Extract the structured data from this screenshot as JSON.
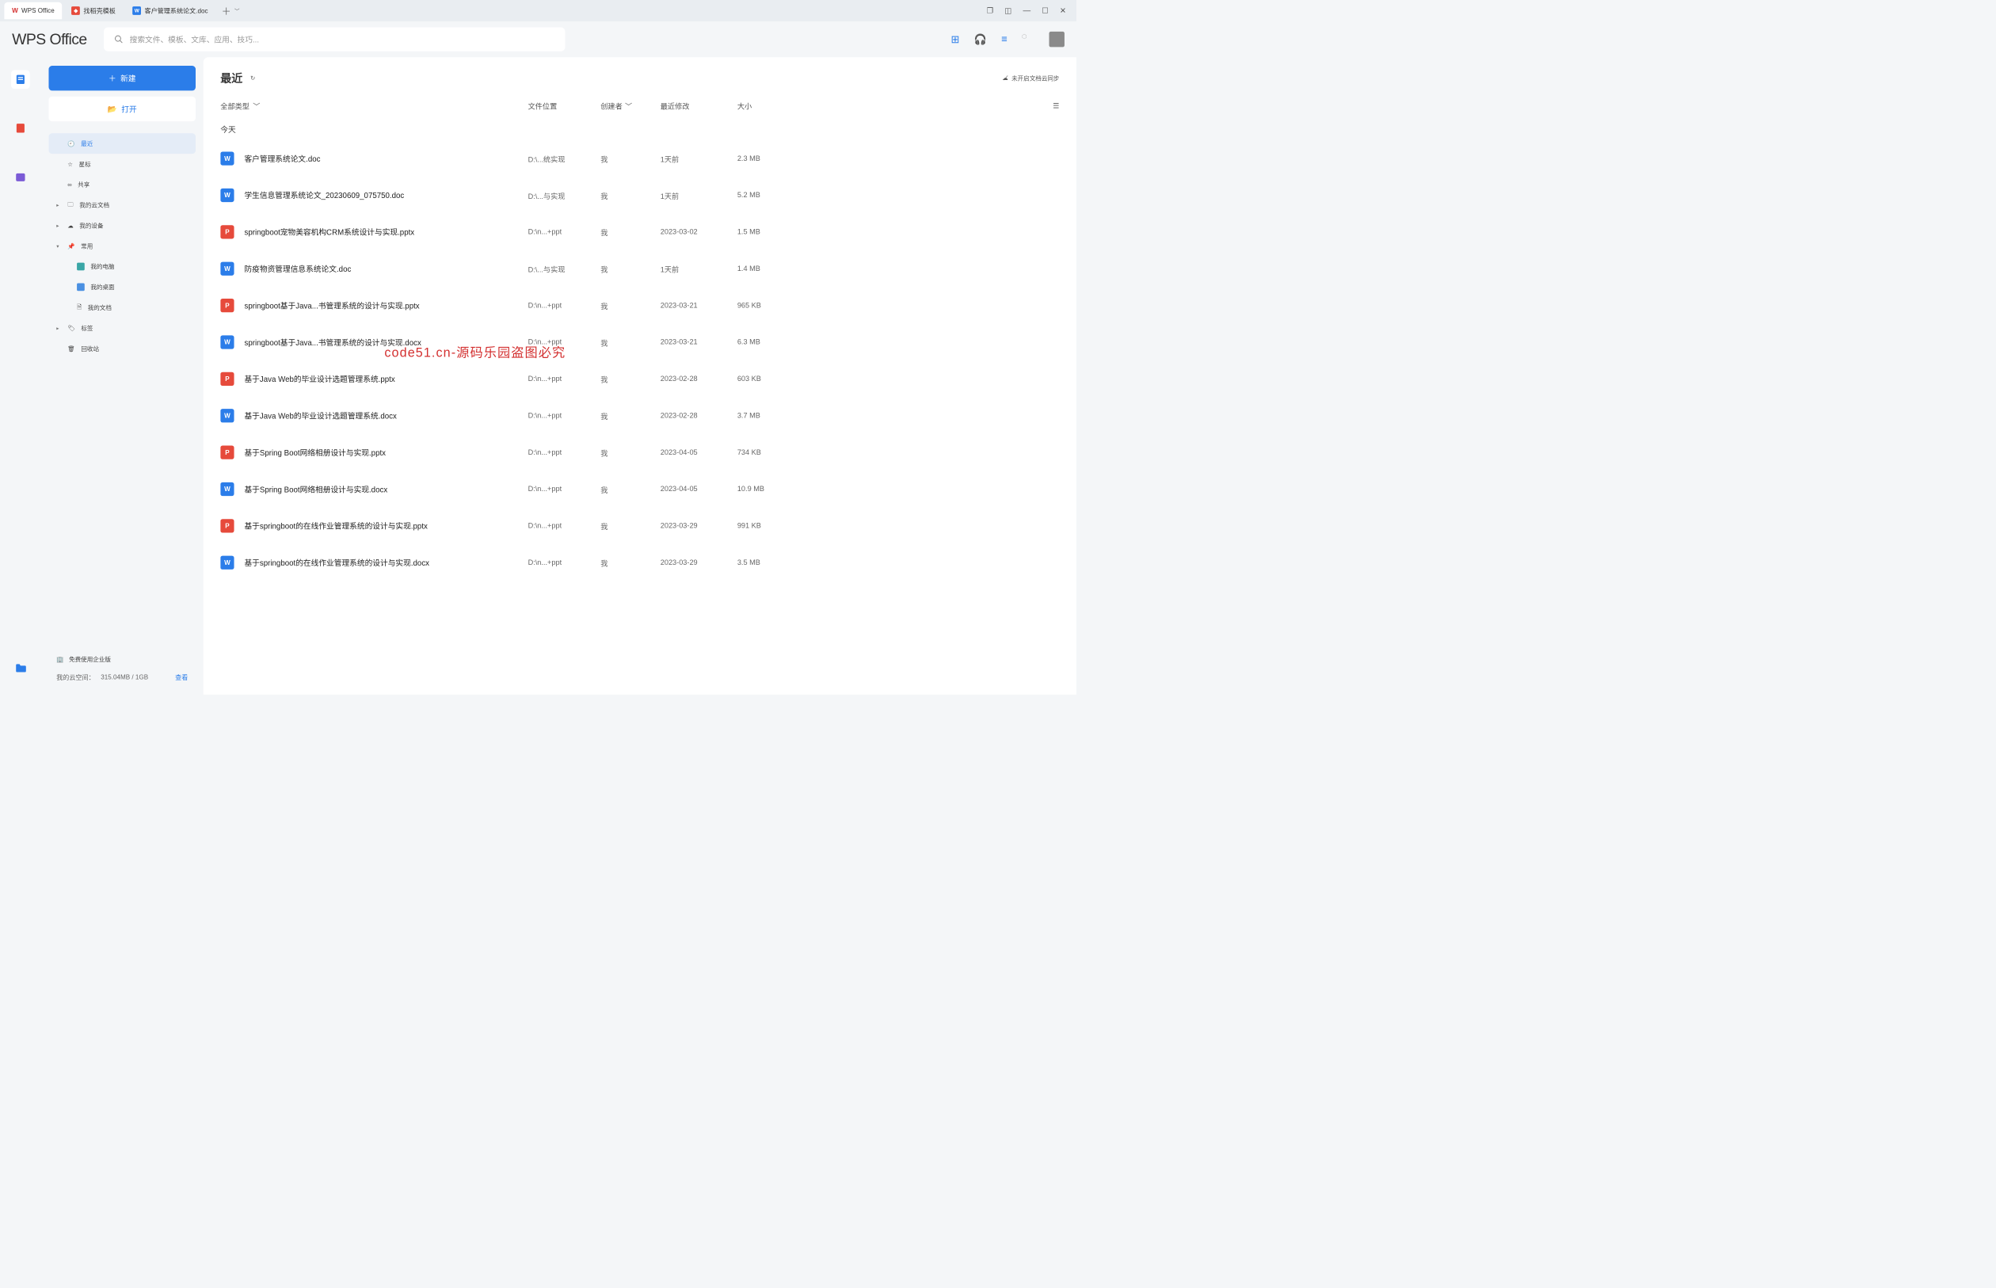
{
  "tabs": [
    {
      "label": "WPS Office",
      "type": "wps"
    },
    {
      "label": "找稻壳模板",
      "type": "tpl"
    },
    {
      "label": "客户管理系统论文.doc",
      "type": "w"
    }
  ],
  "brand": "WPS Office",
  "search_placeholder": "搜索文件、模板、文库、应用、技巧...",
  "btn_new": "新建",
  "btn_open": "打开",
  "nav": {
    "recent": "最近",
    "star": "星标",
    "share": "共享",
    "cloud": "我的云文档",
    "device": "我的设备",
    "common": "常用",
    "computer": "我的电脑",
    "desktop": "我的桌面",
    "documents": "我的文档",
    "tags": "标签",
    "trash": "回收站"
  },
  "enterprise": "免费使用企业版",
  "quota_label": "我的云空间：",
  "quota_value": "315.04MB / 1GB",
  "quota_view": "查看",
  "main": {
    "title": "最近",
    "sync": "未开启文档云同步",
    "filter_all": "全部类型",
    "col_loc": "文件位置",
    "col_creator": "创建者",
    "col_mod": "最近修改",
    "col_size": "大小",
    "section_today": "今天"
  },
  "files": [
    {
      "icon": "w",
      "name": "客户管理系统论文.doc",
      "loc": "D:\\...统实现",
      "creator": "我",
      "mod": "1天前",
      "size": "2.3 MB"
    },
    {
      "icon": "w",
      "name": "学生信息管理系统论文_20230609_075750.doc",
      "loc": "D:\\...与实现",
      "creator": "我",
      "mod": "1天前",
      "size": "5.2 MB"
    },
    {
      "icon": "p",
      "name": "springboot宠物美容机构CRM系统设计与实现.pptx",
      "loc": "D:\\n...+ppt",
      "creator": "我",
      "mod": "2023-03-02",
      "size": "1.5 MB"
    },
    {
      "icon": "w",
      "name": "防疫物资管理信息系统论文.doc",
      "loc": "D:\\...与实现",
      "creator": "我",
      "mod": "1天前",
      "size": "1.4 MB"
    },
    {
      "icon": "p",
      "name": "springboot基于Java...书管理系统的设计与实现.pptx",
      "loc": "D:\\n...+ppt",
      "creator": "我",
      "mod": "2023-03-21",
      "size": "965 KB"
    },
    {
      "icon": "w",
      "name": "springboot基于Java...书管理系统的设计与实现.docx",
      "loc": "D:\\n...+ppt",
      "creator": "我",
      "mod": "2023-03-21",
      "size": "6.3 MB"
    },
    {
      "icon": "p",
      "name": "基于Java Web的毕业设计选题管理系统.pptx",
      "loc": "D:\\n...+ppt",
      "creator": "我",
      "mod": "2023-02-28",
      "size": "603 KB"
    },
    {
      "icon": "w",
      "name": "基于Java Web的毕业设计选题管理系统.docx",
      "loc": "D:\\n...+ppt",
      "creator": "我",
      "mod": "2023-02-28",
      "size": "3.7 MB"
    },
    {
      "icon": "p",
      "name": "基于Spring Boot网络相册设计与实现.pptx",
      "loc": "D:\\n...+ppt",
      "creator": "我",
      "mod": "2023-04-05",
      "size": "734 KB"
    },
    {
      "icon": "w",
      "name": "基于Spring Boot网络相册设计与实现.docx",
      "loc": "D:\\n...+ppt",
      "creator": "我",
      "mod": "2023-04-05",
      "size": "10.9 MB"
    },
    {
      "icon": "p",
      "name": "基于springboot的在线作业管理系统的设计与实现.pptx",
      "loc": "D:\\n...+ppt",
      "creator": "我",
      "mod": "2023-03-29",
      "size": "991 KB"
    },
    {
      "icon": "w",
      "name": "基于springboot的在线作业管理系统的设计与实现.docx",
      "loc": "D:\\n...+ppt",
      "creator": "我",
      "mod": "2023-03-29",
      "size": "3.5 MB"
    }
  ],
  "watermark": "code51.cn-源码乐园盗图必究"
}
